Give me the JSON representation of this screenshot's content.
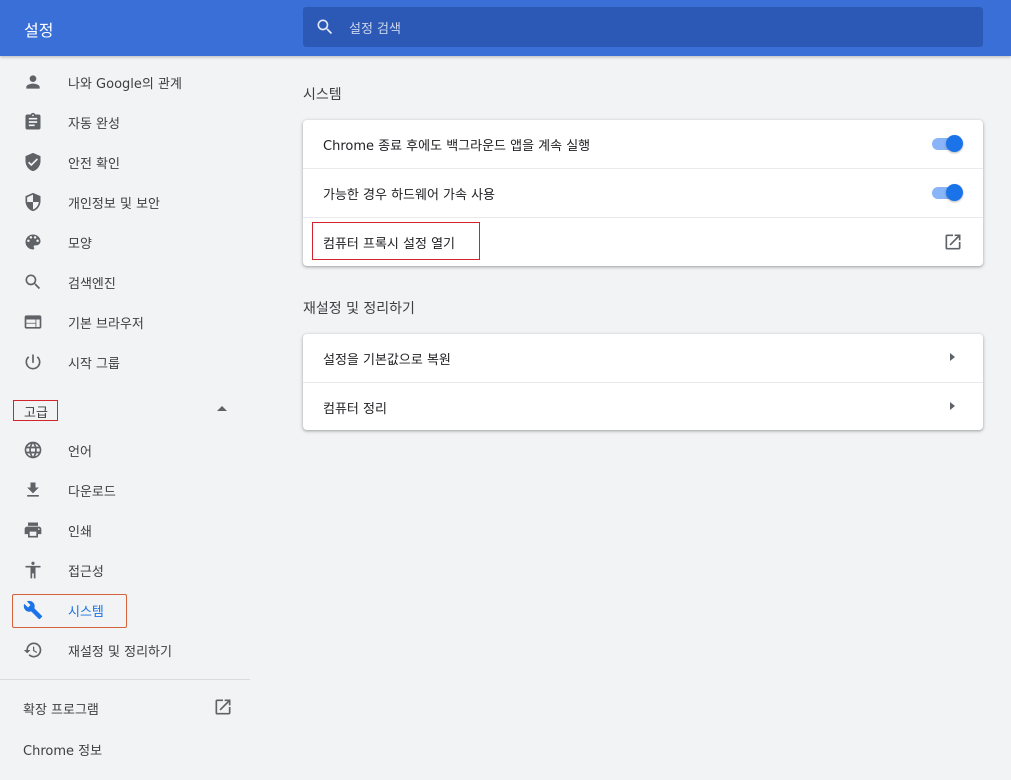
{
  "header": {
    "title": "설정",
    "search_placeholder": "설정 검색"
  },
  "sidebar": {
    "items": [
      {
        "label": "나와 Google의 관계",
        "icon": "person-icon"
      },
      {
        "label": "자동 완성",
        "icon": "clipboard-icon"
      },
      {
        "label": "안전 확인",
        "icon": "shield-check-icon"
      },
      {
        "label": "개인정보 및 보안",
        "icon": "shield-icon"
      },
      {
        "label": "모양",
        "icon": "palette-icon"
      },
      {
        "label": "검색엔진",
        "icon": "search-icon"
      },
      {
        "label": "기본 브라우저",
        "icon": "browser-icon"
      },
      {
        "label": "시작 그룹",
        "icon": "power-icon"
      }
    ],
    "advanced_label": "고급",
    "advanced_items": [
      {
        "label": "언어",
        "icon": "globe-icon"
      },
      {
        "label": "다운로드",
        "icon": "download-icon"
      },
      {
        "label": "인쇄",
        "icon": "printer-icon"
      },
      {
        "label": "접근성",
        "icon": "accessibility-icon"
      },
      {
        "label": "시스템",
        "icon": "wrench-icon",
        "active": true
      },
      {
        "label": "재설정 및 정리하기",
        "icon": "restore-icon"
      }
    ],
    "extensions_label": "확장 프로그램",
    "about_label": "Chrome 정보"
  },
  "main": {
    "system_title": "시스템",
    "system_rows": [
      {
        "label": "Chrome 종료 후에도 백그라운드 앱을 계속 실행",
        "toggle_on": true
      },
      {
        "label": "가능한 경우 하드웨어 가속 사용",
        "toggle_on": true
      },
      {
        "label": "컴퓨터 프록시 설정 열기"
      }
    ],
    "reset_title": "재설정 및 정리하기",
    "reset_rows": [
      {
        "label": "설정을 기본값으로 복원"
      },
      {
        "label": "컴퓨터 정리"
      }
    ]
  },
  "colors": {
    "header": "#3b6fd8",
    "accent": "#1a73e8",
    "highlight_red": "#d3242b",
    "highlight_orange": "#d4623a"
  }
}
